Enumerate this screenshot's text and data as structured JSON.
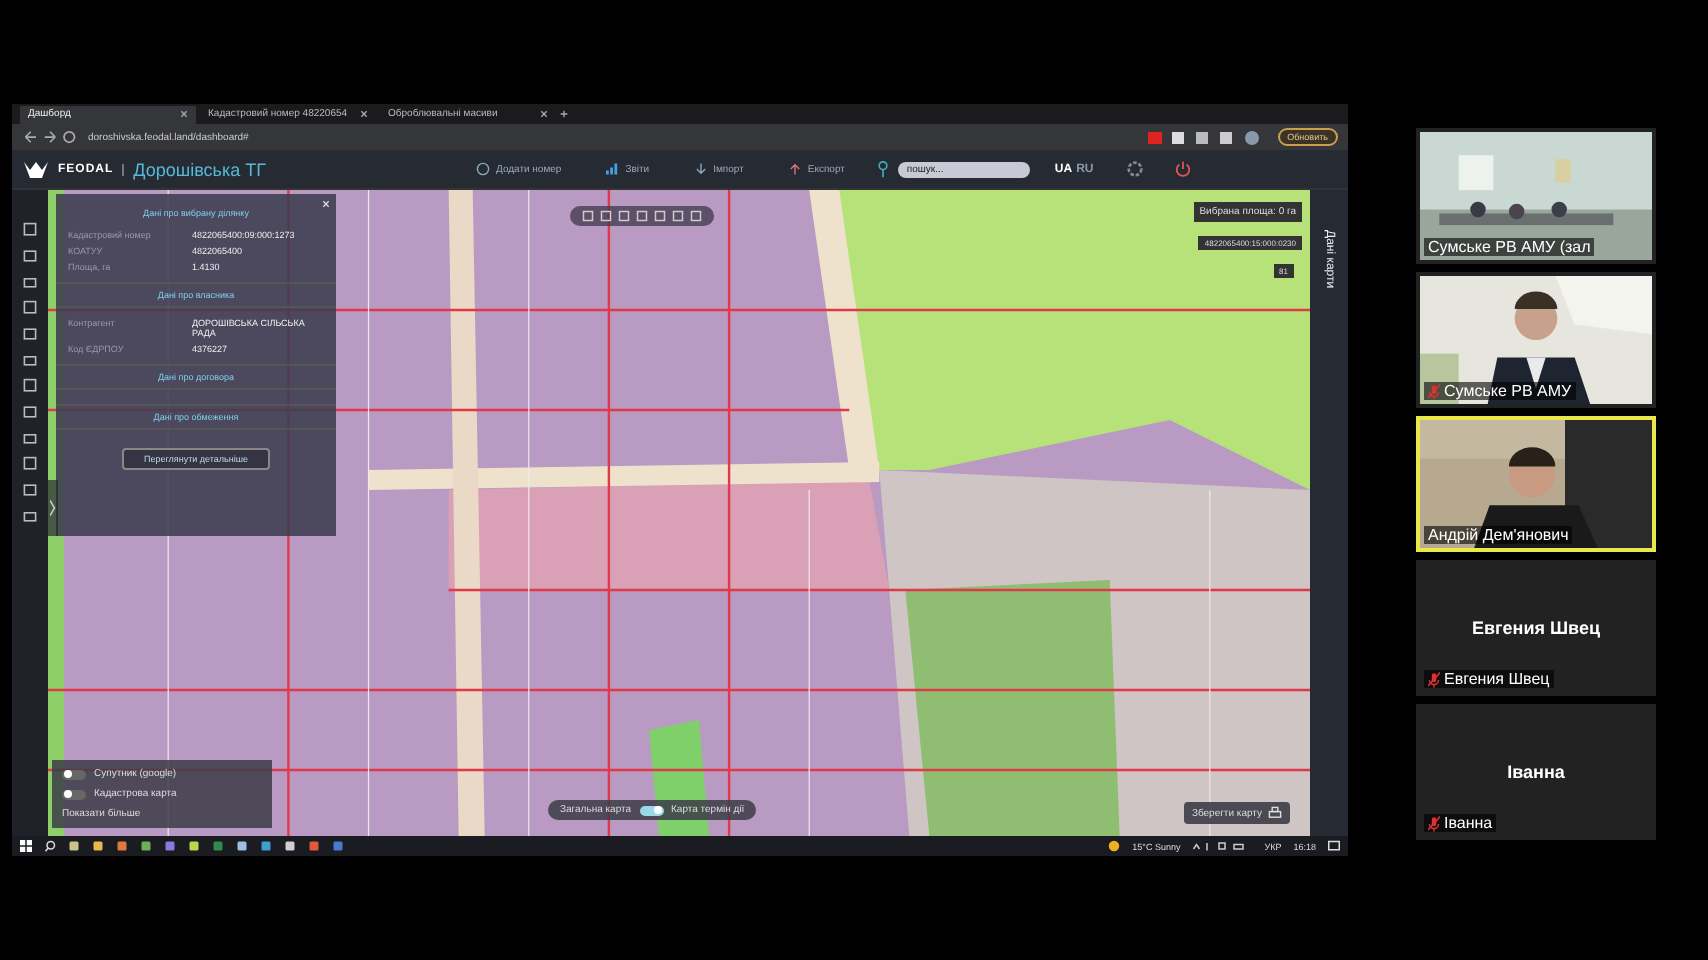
{
  "browser": {
    "tabs": [
      {
        "title": "Дашборд",
        "selected": true
      },
      {
        "title": "Кадастровий номер 48220654",
        "selected": false
      },
      {
        "title": "Оброблювальні масиви",
        "selected": false
      }
    ],
    "address": "doroshivska.feodal.land/dashboard#",
    "update_button": "Обновить"
  },
  "app": {
    "logo": "FEODAL",
    "title": "Дорошівська ТГ",
    "actions": [
      {
        "label": "Додати номер"
      },
      {
        "label": "Звіти"
      },
      {
        "label": "Імпорт"
      },
      {
        "label": "Експорт"
      }
    ],
    "search": {
      "placeholder": "пошук..."
    },
    "languages": [
      {
        "label": "UA",
        "selected": true
      },
      {
        "label": "RU",
        "selected": false
      }
    ]
  },
  "parcel_panel": {
    "title": "Дані про вибрану ділянку",
    "sections": [
      {
        "rows": [
          {
            "label": "Кадастровий номер",
            "value": "4822065400:09:000:1273"
          },
          {
            "label": "КОАТУУ",
            "value": "4822065400"
          },
          {
            "label": "Площа, га",
            "value": "1.4130"
          }
        ]
      },
      {
        "title": "Дані про власника",
        "rows": [
          {
            "label": "Контрагент",
            "value": "ДОРОШІВСЬКА СІЛЬСЬКА РАДА"
          },
          {
            "label": "Код ЄДРПОУ",
            "value": "4376227"
          }
        ]
      },
      {
        "title": "Дані про договора"
      },
      {
        "title": "Дані про обмеження"
      }
    ],
    "button": "Переглянути детальніше"
  },
  "map": {
    "selected_area": "Вибрана площа: 0 га",
    "parcel_label": "4822065400:15:000:0230",
    "zoom_badge": "81",
    "layers": [
      {
        "label": "Супутник (google)",
        "on": false
      },
      {
        "label": "Кадастрова карта",
        "on": false
      }
    ],
    "show_more": "Показати більше",
    "mode_switch": {
      "left": "Загальна карта",
      "right": "Карта термін дії",
      "on": true
    },
    "save_button": "Зберегти карту",
    "side_tab": "Дані карти"
  },
  "taskbar": {
    "weather": "15°C Sunny",
    "language": "УКР",
    "time": "16:18"
  },
  "participants": [
    {
      "kind": "video",
      "name": "Сумське РВ АМУ (зал",
      "muted": false,
      "active": false
    },
    {
      "kind": "video",
      "name": "Сумське РВ АМУ",
      "muted": true,
      "active": false
    },
    {
      "kind": "video",
      "name": "Андрій Дем'янович",
      "muted": false,
      "active": true
    },
    {
      "kind": "avatar",
      "title": "Евгения Швец",
      "name": "Евгения Швец",
      "muted": true,
      "active": false
    },
    {
      "kind": "avatar",
      "title": "Іванна",
      "name": "Іванна",
      "muted": true,
      "active": false
    }
  ]
}
